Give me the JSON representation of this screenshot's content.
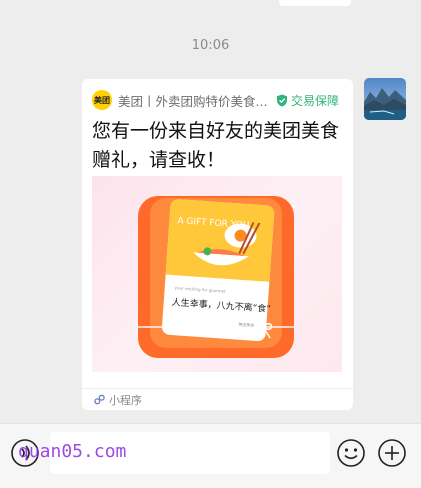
{
  "timestamp": "10:06",
  "message": {
    "logo_text": "美团",
    "source": "美团丨外卖团购特价美食...",
    "badge": "交易保障",
    "title": "您有一份来自好友的美团美食赠礼，请查收！",
    "gift_card": {
      "headline": "A GIFT FOR YOU",
      "small_caption": "your exciting for gourmet",
      "slogan": "人生幸事，八九不离“食”",
      "brand_mark": "美团美食"
    },
    "footer_label": "小程序"
  },
  "input": {
    "value": ""
  },
  "watermark": "quan05.com",
  "colors": {
    "meituan_yellow": "#ffd100",
    "secure_green": "#2fb57b",
    "gift_orange": "#ff6a2b"
  }
}
